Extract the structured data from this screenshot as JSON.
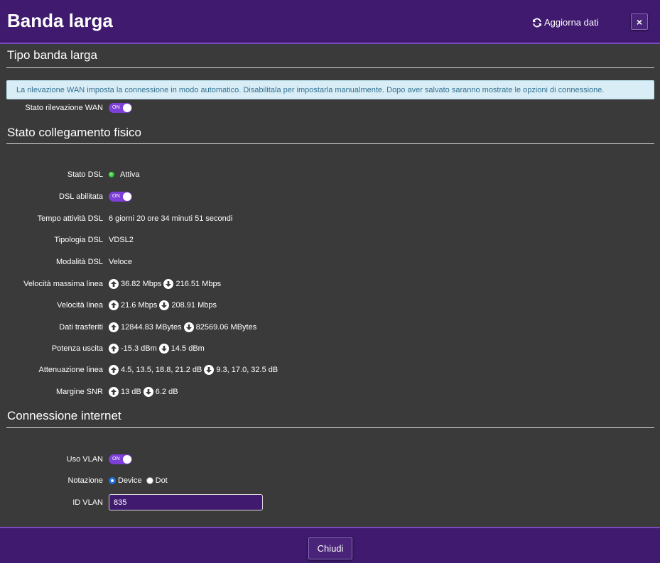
{
  "header": {
    "title": "Banda larga",
    "refresh_label": "Aggiorna dati",
    "close_label": "×"
  },
  "sections": {
    "tipo": "Tipo banda larga",
    "stato": "Stato collegamento fisico",
    "connessione": "Connessione internet"
  },
  "info_message": "La rilevazione WAN imposta la connessione in modo automatico. Disabilitala per impostarla manualmente. Dopo aver salvato saranno mostrate le opzioni di connessione.",
  "toggle_text": "ON",
  "wan": {
    "label": "Stato rilevazione WAN"
  },
  "dsl": {
    "stato_label": "Stato DSL",
    "stato_value": "Attiva",
    "abilitata_label": "DSL abilitata",
    "tempo_label": "Tempo attività DSL",
    "tempo_value": "6 giorni 20 ore 34 minuti 51 secondi",
    "tipologia_label": "Tipologia DSL",
    "tipologia_value": "VDSL2",
    "modalita_label": "Modalità DSL",
    "modalita_value": "Veloce",
    "vel_max_label": "Velocità massima linea",
    "vel_max_up": "36.82 Mbps",
    "vel_max_down": "216.51 Mbps",
    "vel_label": "Velocità linea",
    "vel_up": "21.6 Mbps",
    "vel_down": "208.91 Mbps",
    "dati_label": "Dati trasferiti",
    "dati_up": "12844.83 MBytes",
    "dati_down": "82569.06 MBytes",
    "potenza_label": "Potenza uscita",
    "potenza_up": "-15.3 dBm",
    "potenza_down": "14.5 dBm",
    "attenuazione_label": "Attenuazione linea",
    "attenuazione_up": "4.5, 13.5, 18.8, 21.2 dB",
    "attenuazione_down": "9.3, 17.0, 32.5 dB",
    "snr_label": "Margine SNR",
    "snr_up": "13 dB",
    "snr_down": "6.2 dB"
  },
  "internet": {
    "vlan_label": "Uso VLAN",
    "notazione_label": "Notazione",
    "option_device": "Device",
    "option_dot": "Dot",
    "id_vlan_label": "ID VLAN",
    "id_vlan_value": "835"
  },
  "footer": {
    "close_label": "Chiudi"
  },
  "colors": {
    "header_bg": "#3f1a6e",
    "body_bg": "#3a3a3a",
    "toggle_on": "#7d3fd8",
    "status_active": "#1fae1f",
    "info_bg": "#d9edf7",
    "info_text": "#31708f"
  }
}
